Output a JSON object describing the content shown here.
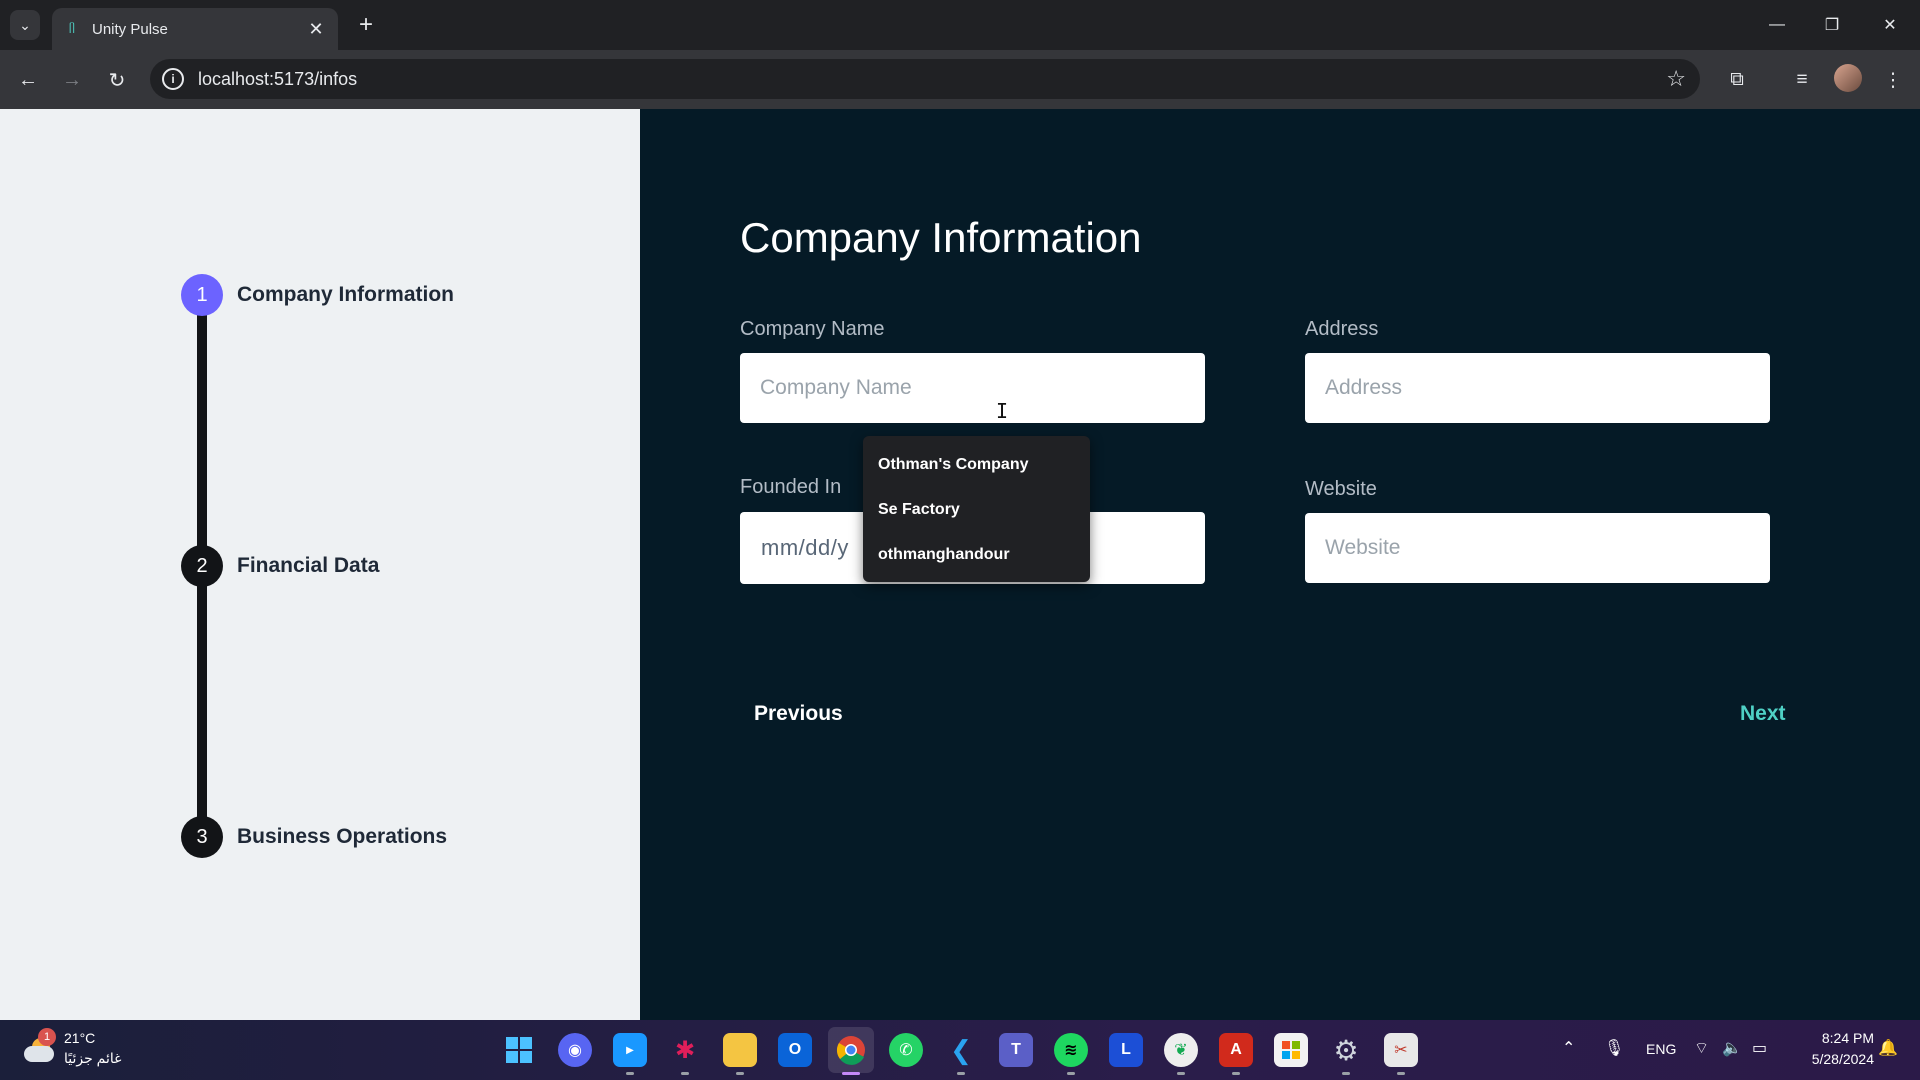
{
  "browser": {
    "tab_title": "Unity Pulse",
    "url": "localhost:5173/infos",
    "new_tab_symbol": "+",
    "close_symbol": "✕"
  },
  "sidebar": {
    "steps": [
      {
        "number": "1",
        "label": "Company Information",
        "active": true
      },
      {
        "number": "2",
        "label": "Financial Data",
        "active": false
      },
      {
        "number": "3",
        "label": "Business Operations",
        "active": false
      }
    ]
  },
  "form": {
    "title": "Company Information",
    "company_name": {
      "label": "Company Name",
      "placeholder": "Company Name",
      "value": ""
    },
    "address": {
      "label": "Address",
      "placeholder": "Address",
      "value": ""
    },
    "founded_in": {
      "label": "Founded In",
      "display": "mm/dd/y"
    },
    "website": {
      "label": "Website",
      "placeholder": "Website",
      "value": ""
    },
    "autocomplete_suggestions": [
      "Othman's Company",
      "Se Factory",
      "othmanghandour"
    ],
    "previous_label": "Previous",
    "next_label": "Next"
  },
  "taskbar": {
    "weather_temp": "21°C",
    "weather_desc": "غائم جزئيًا",
    "weather_badge": "1",
    "language": "ENG",
    "time": "8:24 PM",
    "date": "5/28/2024",
    "apps": [
      "start-icon",
      "discord-icon",
      "prime-video-icon",
      "slack-icon",
      "file-explorer-icon",
      "outlook-icon",
      "chrome-icon",
      "whatsapp-icon",
      "vscode-icon",
      "teams-icon",
      "spotify-icon",
      "l-app-icon",
      "mongodb-icon",
      "acrobat-icon",
      "microsoft-store-icon",
      "settings-icon",
      "snipping-tool-icon"
    ]
  },
  "colors": {
    "left_bg": "#eef1f3",
    "right_bg": "#051a26",
    "accent_purple": "#6c63ff",
    "accent_teal": "#4fd1c5"
  }
}
